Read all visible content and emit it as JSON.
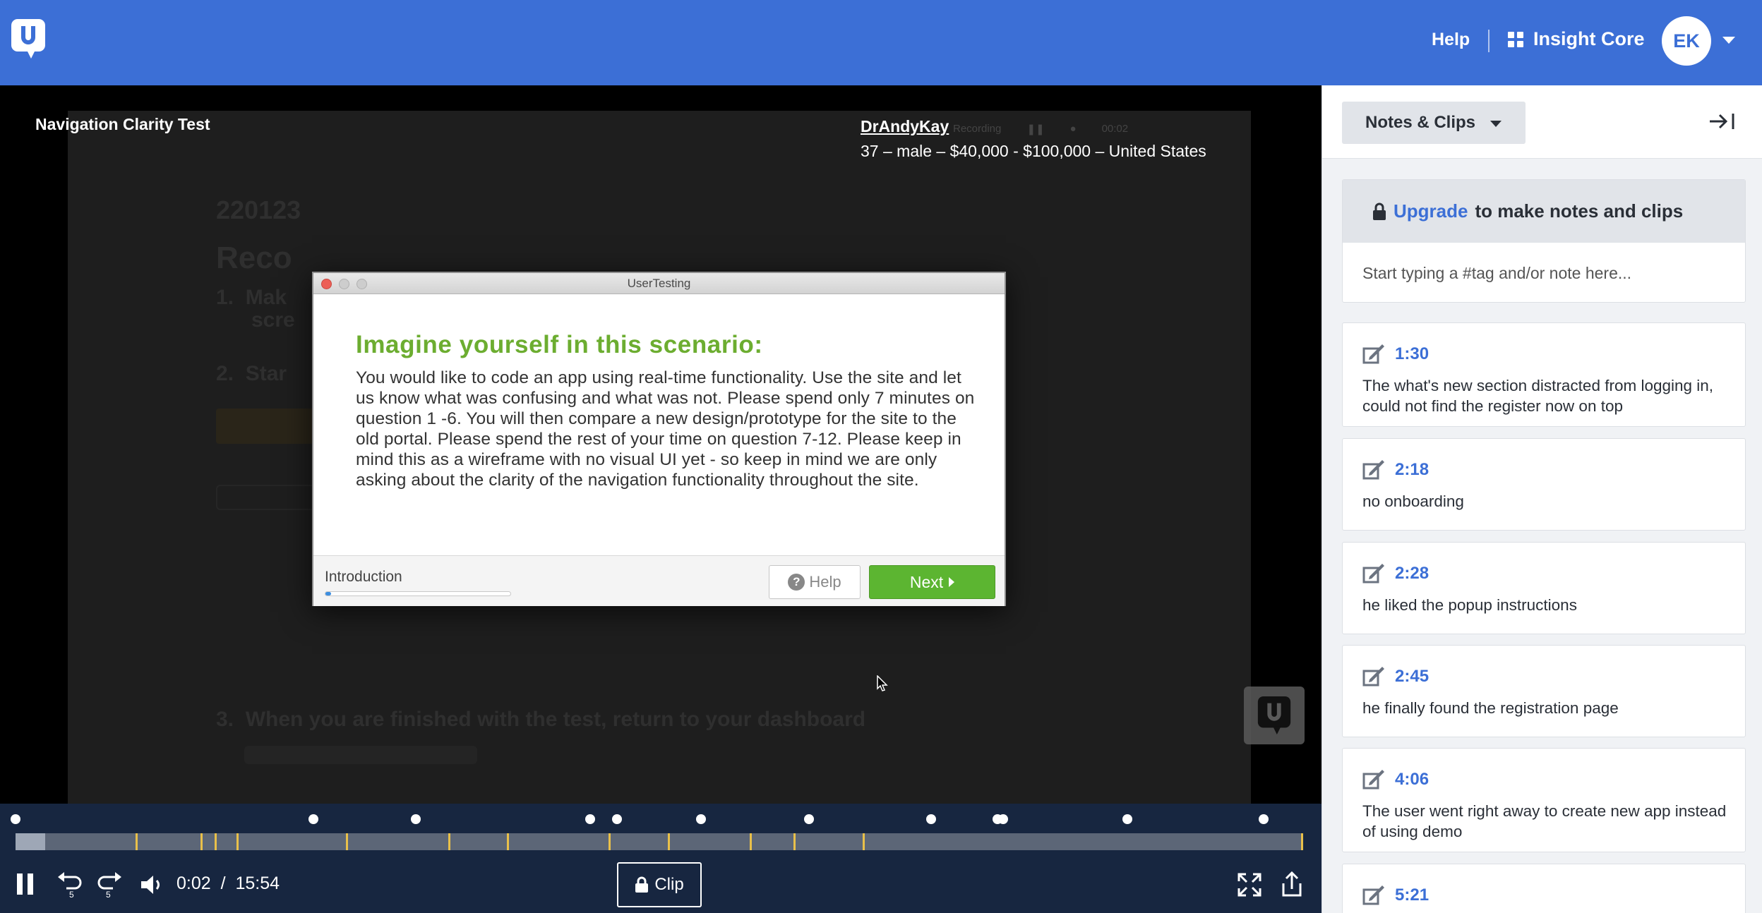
{
  "topbar": {
    "help_label": "Help",
    "workspace_label": "Insight Core",
    "avatar_initials": "EK",
    "colors": {
      "brand": "#3c6fd6"
    }
  },
  "video": {
    "title": "Navigation Clarity Test",
    "participant_name": "DrAndyKay",
    "participant_info": "37 – male – $40,000 - $100,000 – United States"
  },
  "dialog": {
    "window_title": "UserTesting",
    "heading": "Imagine yourself in this scenario:",
    "body": "You would like to code an app using real-time functionality. Use the site and let us know what was confusing and what was not. Please spend only 7 minutes on question 1 -6. You will then compare a new design/prototype for the site to the old portal. Please spend the rest of your time on question 7-12. Please keep in mind this as a wireframe with no visual UI yet - so keep in mind we are only asking about the clarity of the navigation functionality throughout the site.",
    "step_label": "Introduction",
    "step_progress": 0.03,
    "help_label": "Help",
    "next_label": "Next"
  },
  "player": {
    "current_time": "0:02",
    "separator": "/",
    "duration": "15:54",
    "clip_label": "Clip",
    "skip_back_seconds": "5",
    "skip_forward_seconds": "5",
    "played_fraction": 0.002,
    "colors": {
      "bar": "#172640",
      "tick": "#e9c04a"
    }
  },
  "panel": {
    "dropdown_label": "Notes & Clips",
    "upgrade_link": "Upgrade",
    "upgrade_rest": "to make notes and clips",
    "note_placeholder": "Start typing a #tag and/or note here...",
    "notes": [
      {
        "time": "1:30",
        "text": "The what's new section distracted from logging in, could not find the register now on top"
      },
      {
        "time": "2:18",
        "text": "no onboarding"
      },
      {
        "time": "2:28",
        "text": "he liked the popup instructions"
      },
      {
        "time": "2:45",
        "text": "he finally found the registration page"
      },
      {
        "time": "4:06",
        "text": "The user went right away to create new app instead of using demo"
      },
      {
        "time": "5:21",
        "text": ""
      }
    ]
  }
}
